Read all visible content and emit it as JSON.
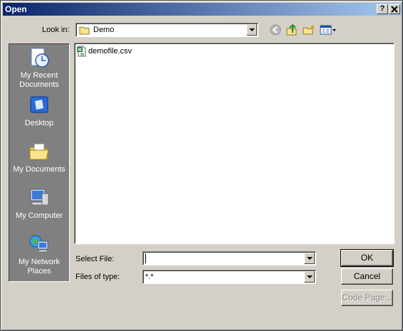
{
  "window": {
    "title": "Open",
    "help_glyph": "?",
    "close_glyph": "X"
  },
  "look_in": {
    "label": "Look in:",
    "value": "Demo"
  },
  "toolbar": {
    "back_icon": "back-arrow-icon",
    "up_icon": "up-folder-icon",
    "new_folder_icon": "new-folder-icon",
    "views_icon": "views-menu-icon"
  },
  "places": [
    {
      "label": "My Recent\nDocuments",
      "icon": "recent-documents-icon"
    },
    {
      "label": "Desktop",
      "icon": "desktop-icon"
    },
    {
      "label": "My Documents",
      "icon": "my-documents-icon"
    },
    {
      "label": "My Computer",
      "icon": "my-computer-icon"
    },
    {
      "label": "My Network\nPlaces",
      "icon": "network-places-icon"
    }
  ],
  "files": [
    {
      "name": "demofile.csv",
      "icon": "csv-file-icon"
    }
  ],
  "select_file": {
    "label": "Select File:",
    "value": ""
  },
  "files_of_type": {
    "label": "Files of type:",
    "value": "*.*"
  },
  "buttons": {
    "ok": "OK",
    "cancel": "Cancel",
    "code_page": "Code Page..."
  },
  "colors": {
    "title_start": "#0a246a",
    "title_end": "#a6caf0",
    "face": "#d4d0c8",
    "places_bg": "#808080"
  }
}
